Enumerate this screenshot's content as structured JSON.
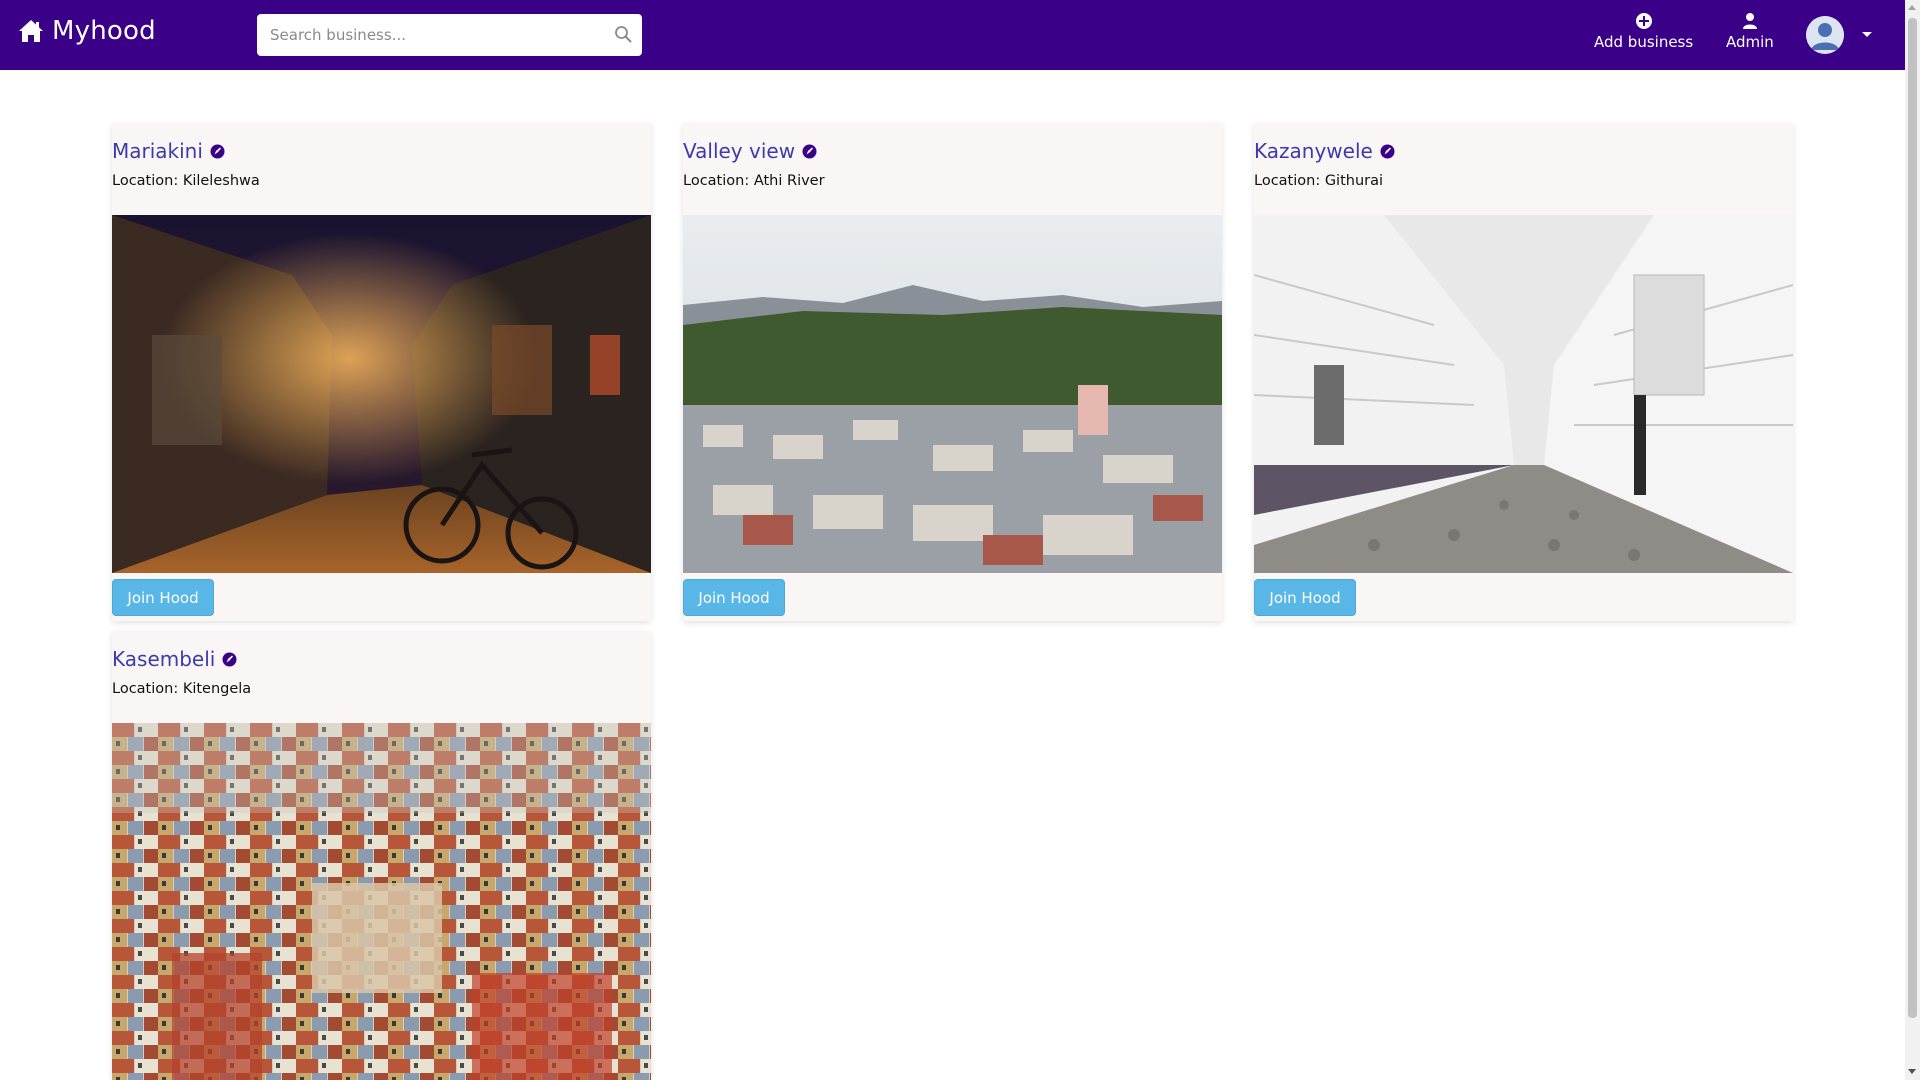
{
  "navbar": {
    "brand": "Myhood",
    "search_placeholder": "Search business...",
    "add_business_label": "Add business",
    "admin_label": "Admin",
    "background_color": "#3a0088"
  },
  "cards": [
    {
      "name": "Mariakini",
      "location": "Location: Kileleshwa",
      "image": "night street with bicycle",
      "button": "Join Hood"
    },
    {
      "name": "Valley view",
      "location": "Location: Athi River",
      "image": "aerial view of hilly town",
      "button": "Join Hood"
    },
    {
      "name": "Kazanywele",
      "location": "Location: Githurai",
      "image": "white wooden houses on cobblestone street",
      "button": "Join Hood"
    },
    {
      "name": "Kasembeli",
      "location": "Location: Kitengela",
      "image": "dense colorful city buildings",
      "button": ""
    }
  ],
  "colors": {
    "accent": "#3a0088",
    "title_link": "#3d3bab",
    "button": "#58b7e6",
    "card_bg": "#faf6f6"
  }
}
